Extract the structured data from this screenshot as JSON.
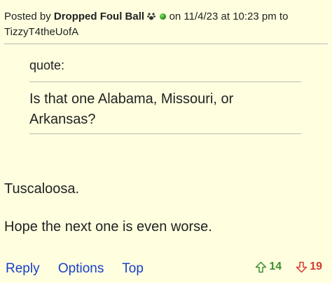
{
  "post": {
    "prefix": "Posted by",
    "author": "Dropped Foul Ball",
    "date_text": "on 11/4/23 at 10:23 pm to",
    "recipient": "TizzyT4theUofA",
    "icons": [
      "paw-icon",
      "green-dot-icon"
    ]
  },
  "quote": {
    "label": "quote:",
    "text": "Is that one Alabama, Missouri, or Arkansas?"
  },
  "body": {
    "line1": "Tuscaloosa.",
    "line2": "Hope the next one is even worse."
  },
  "actions": {
    "reply": "Reply",
    "options": "Options",
    "top": "Top"
  },
  "votes": {
    "up_count": "14",
    "down_count": "19",
    "up_color": "#3f8f2d",
    "down_color": "#d63a2f",
    "link_color": "#1a3ec8"
  }
}
